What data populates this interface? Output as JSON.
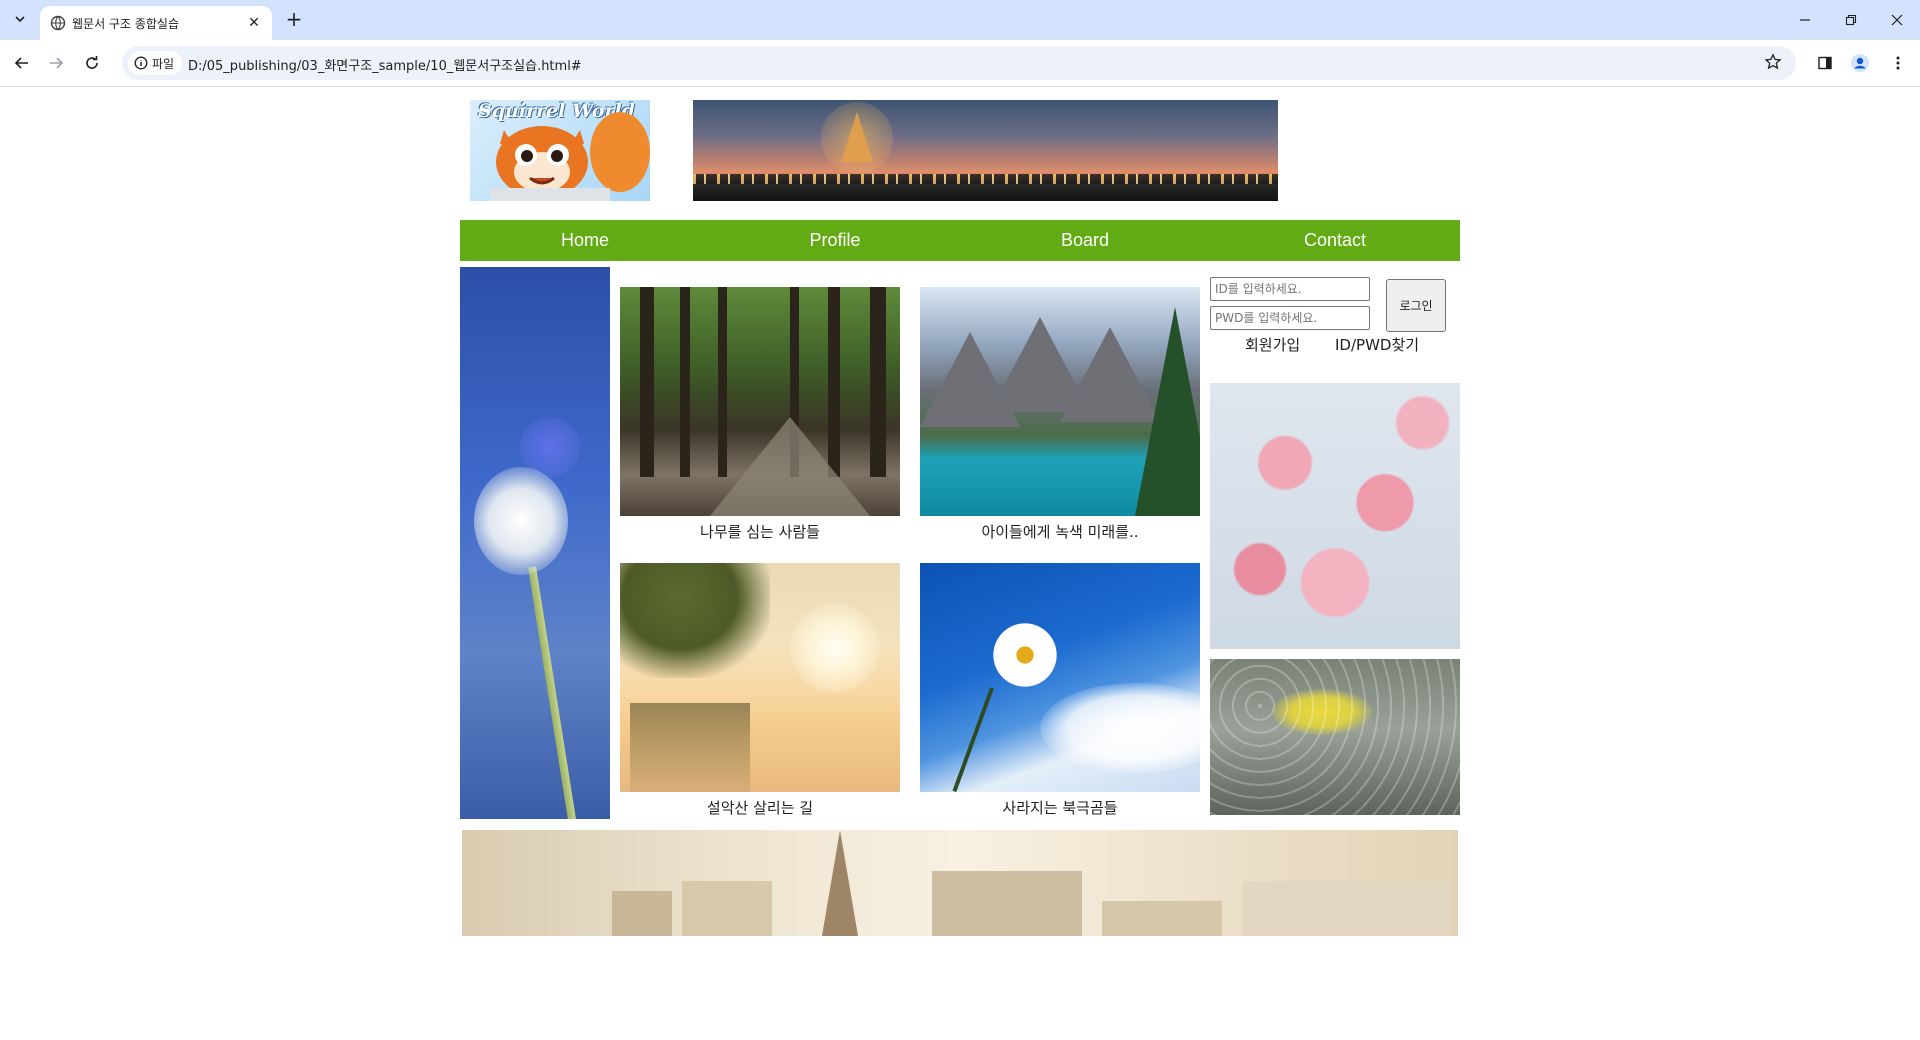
{
  "browser": {
    "tab_title": "웹문서 구조 종합실습",
    "site_chip": "파일",
    "url": "D:/05_publishing/03_화면구조_sample/10_웹문서구조실습.html#"
  },
  "header": {
    "logo_text": "Squirrel World"
  },
  "nav": {
    "items": [
      "Home",
      "Profile",
      "Board",
      "Contact"
    ]
  },
  "cards": [
    {
      "caption": "나무를 심는 사람들"
    },
    {
      "caption": "아이들에게 녹색 미래를.."
    },
    {
      "caption": "설악산 살리는 길"
    },
    {
      "caption": "사라지는 북극곰들"
    }
  ],
  "login": {
    "id_placeholder": "ID를 입력하세요.",
    "pwd_placeholder": "PWD를 입력하세요.",
    "button_label": "로그인",
    "signup_label": "회원가입",
    "find_label": "ID/PWD찾기"
  },
  "colors": {
    "nav_bg": "#63ab14",
    "chrome_tabbar": "#d3e3fd"
  }
}
